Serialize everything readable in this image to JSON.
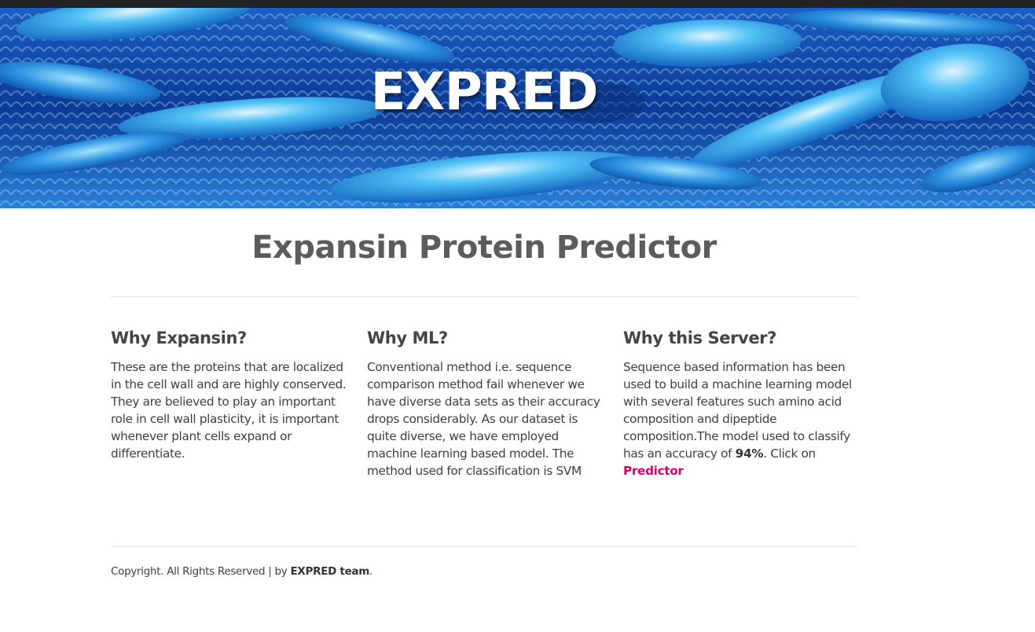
{
  "hero": {
    "title": "EXPRED"
  },
  "page_title": "Expansin Protein Predictor",
  "columns": [
    {
      "heading": "Why Expansin?",
      "body": "These are the proteins that are localized in the cell wall and are highly conserved. They are believed to play an important role in cell wall plasticity, it is important whenever plant cells expand or differentiate."
    },
    {
      "heading": "Why ML?",
      "body": "Conventional method i.e. sequence comparison method fail whenever we have diverse data sets as their accuracy drops considerably. As our dataset is quite diverse, we have employed machine learning based model. The method used for classification is SVM"
    },
    {
      "heading": "Why this Server?",
      "body_before": "Sequence based information has been used to build a machine learning model with several features such amino acid composition and dipeptide composition.The model used to classify has an accuracy of ",
      "accuracy": "94%",
      "body_after": ". Click on",
      "link_label": "Predictor"
    }
  ],
  "footer": {
    "text": "Copyright. All Rights Reserved | by ",
    "team": "EXPRED team",
    "end": "."
  },
  "colors": {
    "link": "#d6006d",
    "topbar": "#222222",
    "hero_base": "#0a3c8a"
  }
}
